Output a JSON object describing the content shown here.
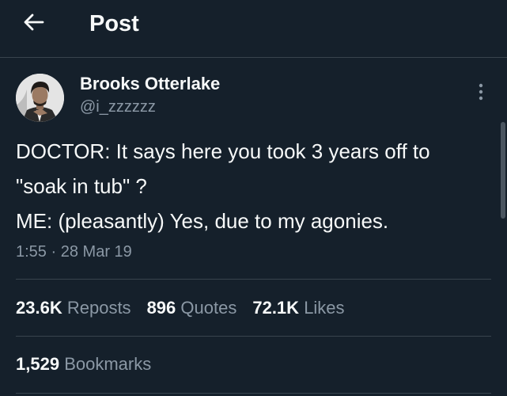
{
  "header": {
    "title": "Post",
    "back_icon": "arrow-left-icon"
  },
  "post": {
    "author": {
      "name": "Brooks Otterlake",
      "handle": "@i_zzzzzz"
    },
    "text_lines": [
      "DOCTOR: It says here you took 3 years off to",
      "\"soak in tub\" ?",
      "ME: (pleasantly) Yes, due to my agonies."
    ],
    "time": "1:55",
    "separator": "·",
    "date": "28 Mar 19",
    "stats": {
      "reposts": {
        "value": "23.6K",
        "label": "Reposts"
      },
      "quotes": {
        "value": "896",
        "label": "Quotes"
      },
      "likes": {
        "value": "72.1K",
        "label": "Likes"
      }
    },
    "bookmarks": {
      "value": "1,529",
      "label": "Bookmarks"
    }
  },
  "colors": {
    "background": "#15202b",
    "text_primary": "#f7f9f9",
    "text_secondary": "#8b98a5",
    "divider": "#38444d"
  }
}
